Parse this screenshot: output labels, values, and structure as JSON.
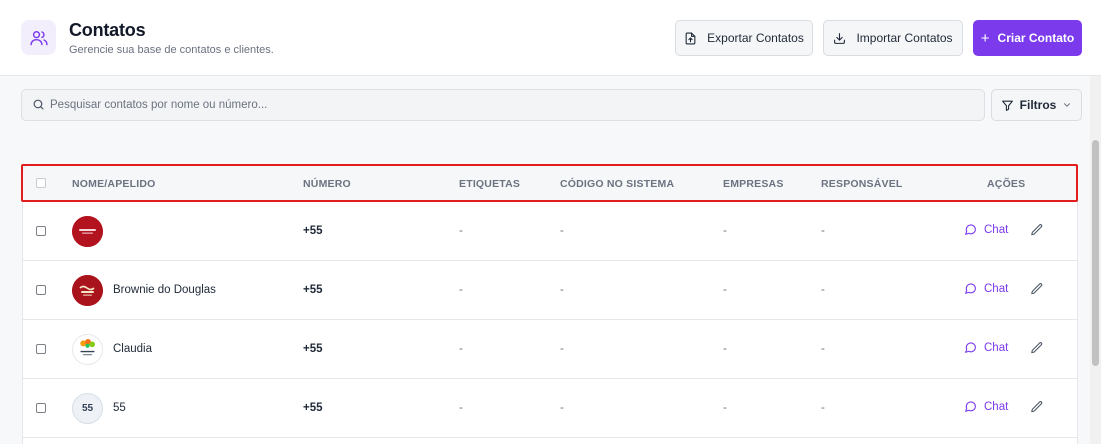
{
  "header": {
    "title": "Contatos",
    "subtitle": "Gerencie sua base de contatos e clientes.",
    "icon": "users-icon",
    "export_label": "Exportar Contatos",
    "import_label": "Importar Contatos",
    "create_label": "Criar Contato"
  },
  "search": {
    "placeholder": "Pesquisar contatos por nome ou número...",
    "value": ""
  },
  "filters": {
    "label": "Filtros"
  },
  "table": {
    "columns": [
      "NOME/APELIDO",
      "NÚMERO",
      "ETIQUETAS",
      "CÓDIGO NO SISTEMA",
      "EMPRESAS",
      "RESPONSÁVEL",
      "AÇÕES"
    ],
    "rows": [
      {
        "name": "",
        "number": "+55",
        "tags": "-",
        "system_code": "-",
        "companies": "-",
        "responsible": "-",
        "avatar": "red-brand-logo",
        "avatar_text": "",
        "chat_label": "Chat"
      },
      {
        "name": "Brownie do Douglas",
        "number": "+55",
        "tags": "-",
        "system_code": "-",
        "companies": "-",
        "responsible": "-",
        "avatar": "brownie-logo",
        "avatar_text": "",
        "chat_label": "Chat"
      },
      {
        "name": "Claudia",
        "number": "+55",
        "tags": "-",
        "system_code": "-",
        "companies": "-",
        "responsible": "-",
        "avatar": "floral-logo",
        "avatar_text": "",
        "chat_label": "Chat"
      },
      {
        "name": "55",
        "number": "+55",
        "tags": "-",
        "system_code": "-",
        "companies": "-",
        "responsible": "-",
        "avatar": "initials",
        "avatar_text": "55",
        "chat_label": "Chat"
      }
    ]
  },
  "colors": {
    "accent": "#7c3aed",
    "highlight": "#e11d1d",
    "avatar_red": "#b3131f"
  }
}
